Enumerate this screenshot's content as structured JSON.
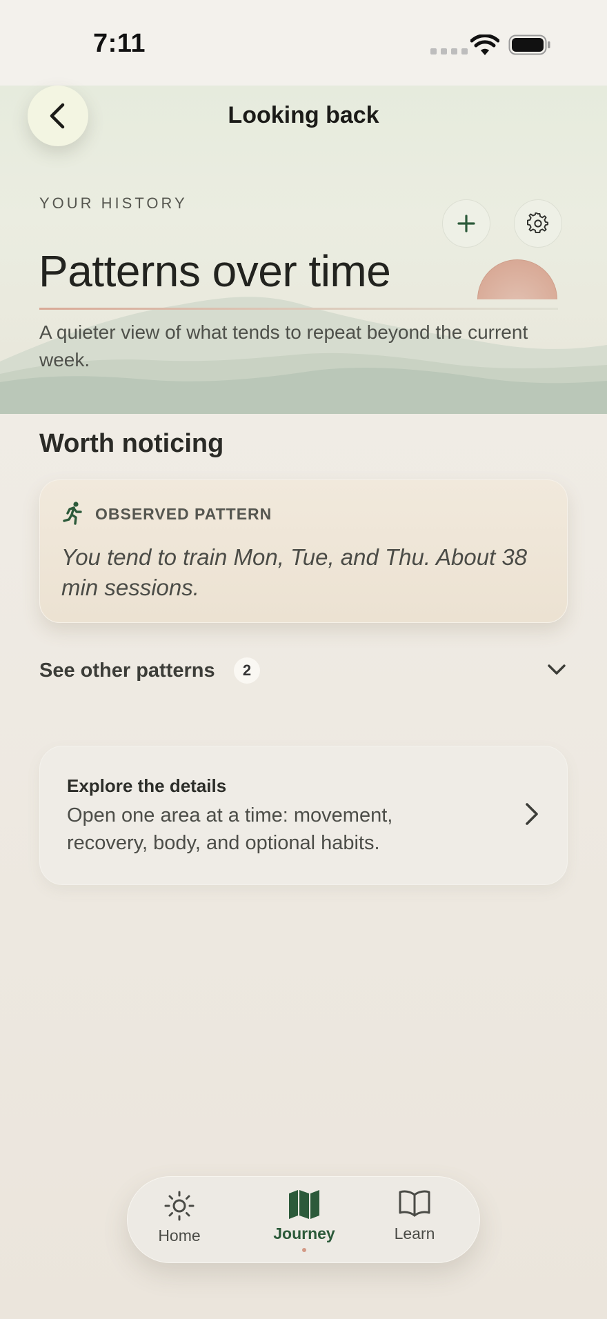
{
  "status_bar": {
    "time": "7:11"
  },
  "header": {
    "title": "Looking back"
  },
  "hero": {
    "eyebrow": "YOUR HISTORY",
    "title": "Patterns over time",
    "subtitle": "A quieter view of what tends to repeat beyond the current week."
  },
  "worth_noticing": {
    "title": "Worth noticing",
    "pattern_card": {
      "icon": "running-person-icon",
      "label": "OBSERVED PATTERN",
      "text": "You tend to train Mon, Tue, and Thu. About 38 min sessions."
    },
    "other_patterns": {
      "label": "See other patterns",
      "count": "2"
    }
  },
  "explore": {
    "title": "Explore the details",
    "body": "Open one area at a time: movement, recovery, body, and optional habits."
  },
  "tabbar": {
    "items": [
      {
        "label": "Home",
        "icon": "sun-icon"
      },
      {
        "label": "Journey",
        "icon": "map-icon",
        "active": true
      },
      {
        "label": "Learn",
        "icon": "book-icon"
      }
    ]
  },
  "colors": {
    "accent_green": "#2c5a3a",
    "peach": "#d9ab98",
    "background": "#efebe4"
  }
}
